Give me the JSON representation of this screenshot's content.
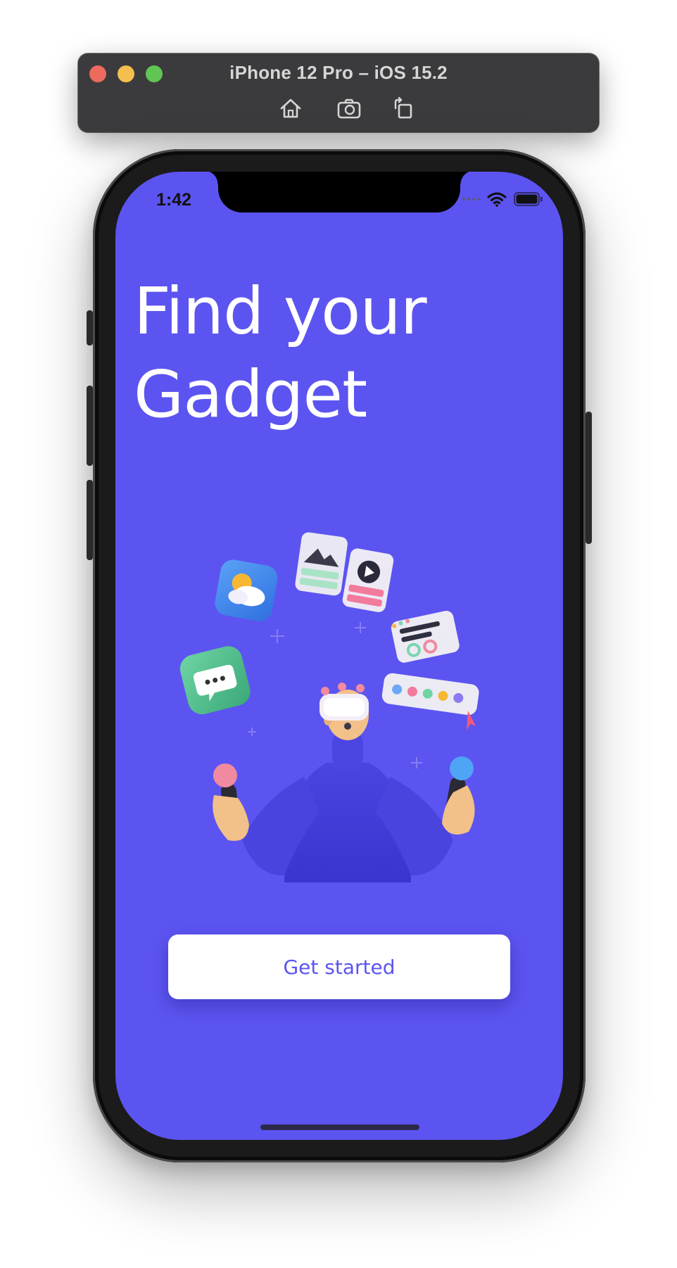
{
  "simulator": {
    "window_title": "iPhone 12 Pro – iOS 15.2",
    "toolbar": {
      "home_icon": "home-icon",
      "screenshot_icon": "camera-icon",
      "rotate_icon": "rotate-icon"
    }
  },
  "status_bar": {
    "time": "1:42",
    "icons": [
      "signal-icon",
      "wifi-icon",
      "battery-icon"
    ]
  },
  "hero": {
    "title_line_1": "Find your",
    "title_line_2": "Gadget"
  },
  "illustration": {
    "icon": "vr-person-juggling-apps-illustration"
  },
  "cta": {
    "label": "Get started"
  },
  "colors": {
    "background": "#5c54f0",
    "button_bg": "#ffffff",
    "button_text": "#5c54f0",
    "title_text": "#ffffff"
  }
}
